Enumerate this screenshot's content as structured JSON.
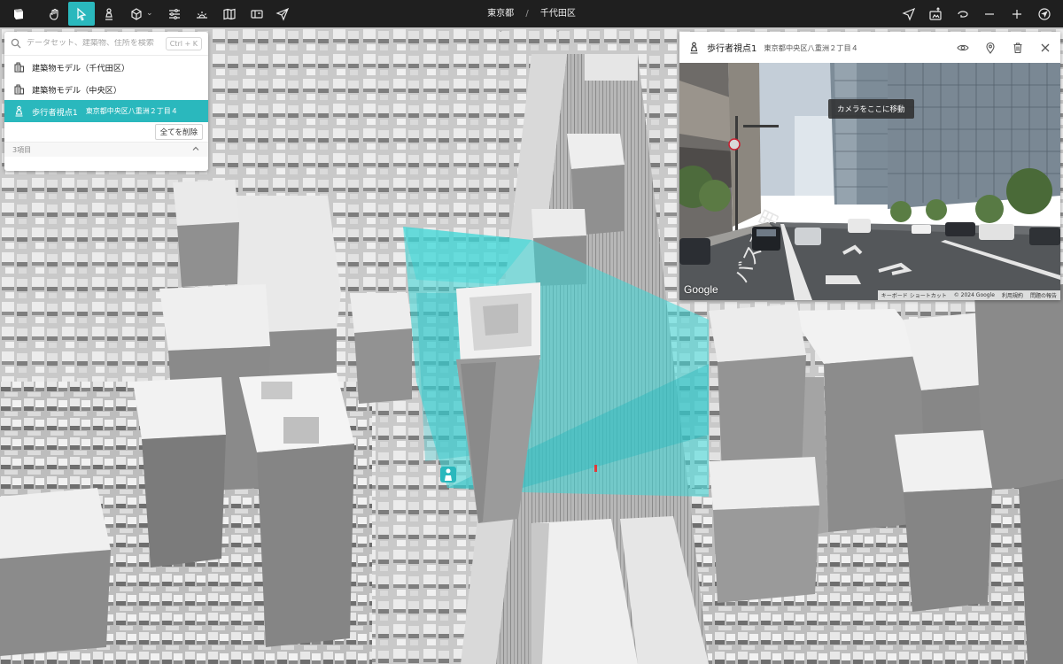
{
  "breadcrumb": {
    "prefecture": "東京都",
    "ward": "千代田区"
  },
  "search": {
    "placeholder": "データセット、建築物、住所を検索",
    "shortcut": "Ctrl + K",
    "items": [
      {
        "label": "建築物モデル（千代田区）",
        "icon": "building-layer-icon"
      },
      {
        "label": "建築物モデル（中央区）",
        "icon": "building-layer-icon"
      },
      {
        "label": "歩行者視点1",
        "sub": "東京都中央区八重洲２丁目４",
        "icon": "pedestrian-icon"
      }
    ],
    "clear_label": "全てを削除",
    "count_label": "3項目"
  },
  "viewer": {
    "title": "歩行者視点1",
    "address": "東京都中央区八重洲２丁目４",
    "move_camera_label": "カメラをここに移動",
    "google_label": "Google",
    "attribution": [
      "キーボード ショートカット",
      "© 2024 Google",
      "利用規約",
      "問題の報告"
    ]
  },
  "colors": {
    "accent": "#2ab8bd",
    "toolbar": "#1f1f1f",
    "highlight": "#3cd8d8"
  }
}
